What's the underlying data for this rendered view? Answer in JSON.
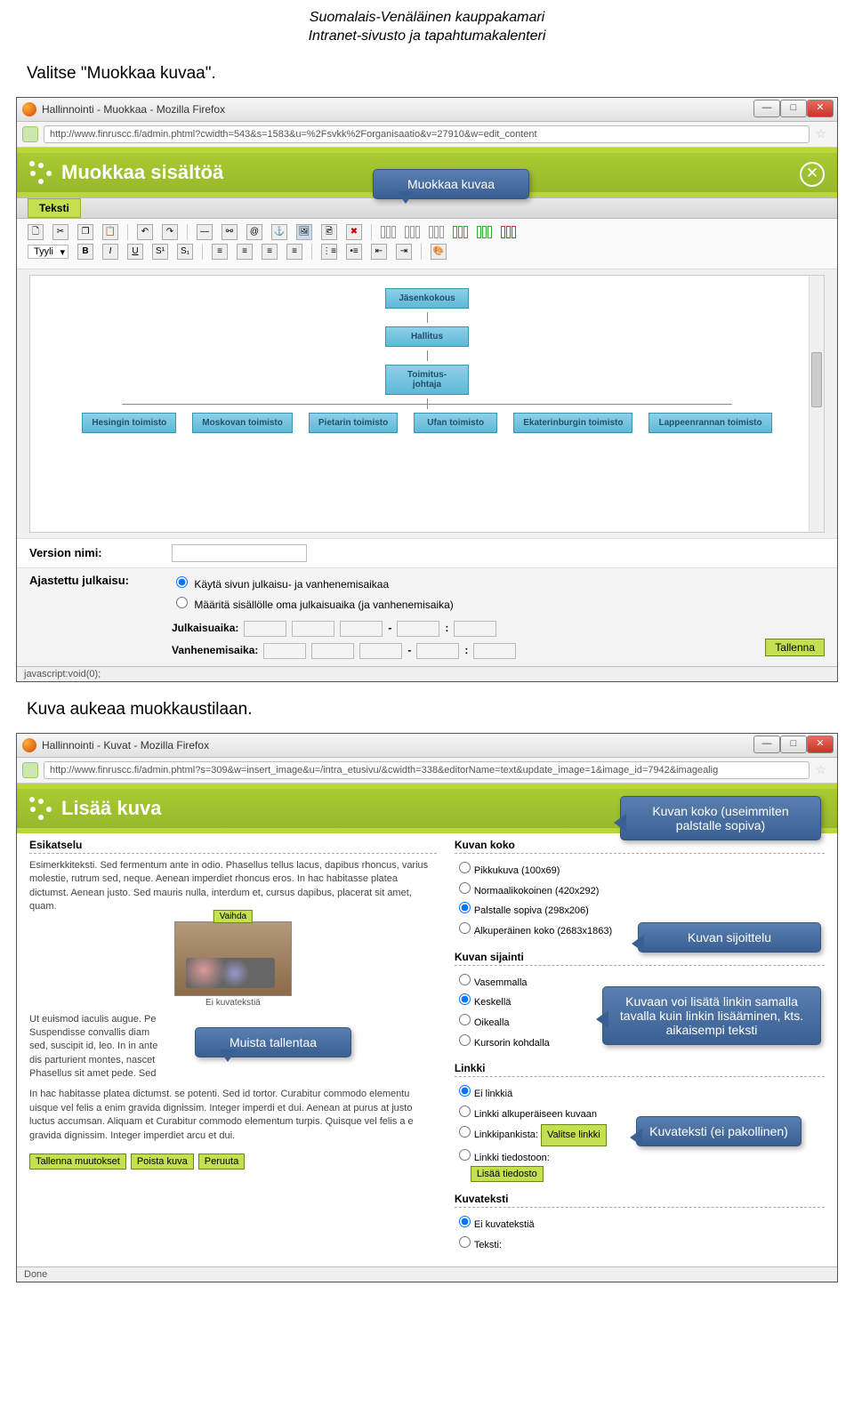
{
  "doc_header": {
    "line1": "Suomalais-Venäläinen kauppakamari",
    "line2": "Intranet-sivusto ja tapahtumakalenteri"
  },
  "instruction1": "Valitse \"Muokkaa kuvaa\".",
  "instruction2": "Kuva aukeaa muokkaustilaan.",
  "window1": {
    "title": "Hallinnointi - Muokkaa - Mozilla Firefox",
    "url": "http://www.finruscc.fi/admin.phtml?cwidth=543&s=1583&u=%2Fsvkk%2Forganisaatio&v=27910&w=edit_content",
    "panel_title": "Muokkaa sisältöä",
    "tab": "Teksti",
    "style_label": "Tyyli",
    "org_boxes": {
      "top": "Jäsenkokous",
      "mid": "Hallitus",
      "low": "Toimitus-\njohtaja",
      "bottom": [
        "Hesingin toimisto",
        "Moskovan toimisto",
        "Pietarin toimisto",
        "Ufan toimisto",
        "Ekaterinburgin toimisto",
        "Lappeenrannan toimisto"
      ]
    },
    "version_label": "Version nimi:",
    "schedule_label": "Ajastettu julkaisu:",
    "radio1": "Käytä sivun julkaisu- ja vanhenemisaikaa",
    "radio2": "Määritä sisällölle oma julkaisuaika (ja vanhenemisaika)",
    "publish_time": "Julkaisuaika:",
    "expire_time": "Vanhenemisaika:",
    "save_btn": "Tallenna",
    "status": "javascript:void(0);"
  },
  "callouts": {
    "c1": "Muokkaa kuvaa",
    "c2": "Kuvan koko (useimmiten palstalle sopiva)",
    "c3": "Kuvan sijoittelu",
    "c4": "Muista tallentaa",
    "c5": "Kuvaan voi lisätä linkin samalla tavalla kuin linkin lisääminen, kts. aikaisempi teksti",
    "c6": "Kuvateksti (ei pakollinen)"
  },
  "window2": {
    "title": "Hallinnointi - Kuvat - Mozilla Firefox",
    "url": "http://www.finruscc.fi/admin.phtml?s=309&w=insert_image&u=/intra_etusivu/&cwidth=338&editorName=text&update_image=1&image_id=7942&imagealig",
    "panel_title": "Lisää kuva",
    "preview_title": "Esikatselu",
    "lorem1": "Esimerkkiteksti. Sed fermentum ante in odio. Phasellus tellus lacus, dapibus rhoncus, varius molestie, rutrum sed, neque. Aenean imperdiet rhoncus eros. In hac habitasse platea dictumst. Aenean justo. Sed mauris nulla, interdum et, cursus dapibus, placerat sit amet, quam.",
    "vaihda": "Vaihda",
    "no_caption": "Ei kuvatekstiä",
    "lorem2": "Ut euismod iaculis augue. Pe\nSuspendisse convallis diam\nsed, suscipit id, leo. In in ante\ndis parturient montes, nascet\nPhasellus sit amet pede. Sed",
    "lorem3": "In hac habitasse platea dictumst.             se potenti. Sed id tortor. Curabitur commodo elementu         uisque vel felis a enim gravida dignissim. Integer imperdi     et dui. Aenean at purus at justo luctus accumsan. Aliquam et       Curabitur commodo elementum turpis. Quisque vel felis a e    gravida dignissim. Integer imperdiet arcu et dui.",
    "btn_save": "Tallenna muutokset",
    "btn_delete": "Poista kuva",
    "btn_cancel": "Peruuta",
    "size_title": "Kuvan koko",
    "size_opts": [
      "Pikkukuva (100x69)",
      "Normaalikokoinen (420x292)",
      "Palstalle sopiva (298x206)",
      "Alkuperäinen koko (2683x1863)"
    ],
    "pos_title": "Kuvan sijainti",
    "pos_opts": [
      "Vasemmalla",
      "Keskellä",
      "Oikealla",
      "Kursorin kohdalla"
    ],
    "link_title": "Linkki",
    "link_opts": [
      "Ei linkkiä",
      "Linkki alkuperäiseen kuvaan",
      "Linkkipankista:",
      "Linkki tiedostoon:"
    ],
    "select_link": "Valitse linkki",
    "add_file": "Lisää tiedosto",
    "caption_title": "Kuvateksti",
    "caption_opts": [
      "Ei kuvatekstiä",
      "Teksti:"
    ],
    "status": "Done"
  }
}
